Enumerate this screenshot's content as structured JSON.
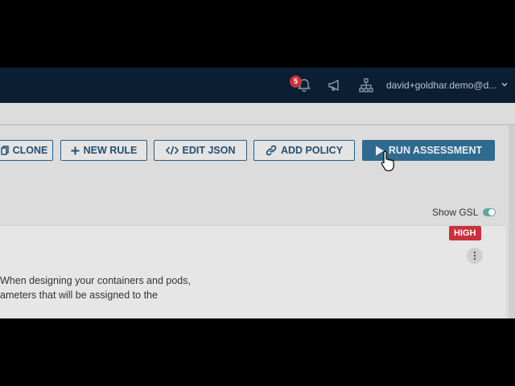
{
  "header": {
    "notification_count": "5",
    "user_email": "david+goldhar.demo@d..."
  },
  "toolbar": {
    "clone_label": "CLONE",
    "new_rule_label": "NEW RULE",
    "edit_json_label": "EDIT JSON",
    "add_policy_label": "ADD POLICY",
    "run_assessment_label": "RUN ASSESSMENT"
  },
  "options": {
    "show_gsl_label": "Show GSL",
    "show_gsl_on": true
  },
  "rule_card": {
    "severity": "HIGH",
    "description_line1": "When designing your containers and pods,",
    "description_line2": "ameters that will be assigned to the"
  },
  "colors": {
    "header_bg": "#0b1e33",
    "primary": "#2f6a8f",
    "danger": "#c9313d",
    "toggle": "#5fa7a0"
  },
  "icons": [
    "bell-icon",
    "megaphone-icon",
    "org-tree-icon",
    "chevron-down-icon",
    "clone-icon",
    "plus-icon",
    "code-icon",
    "link-icon",
    "play-icon",
    "kebab-menu-icon",
    "pointer-cursor-icon"
  ]
}
